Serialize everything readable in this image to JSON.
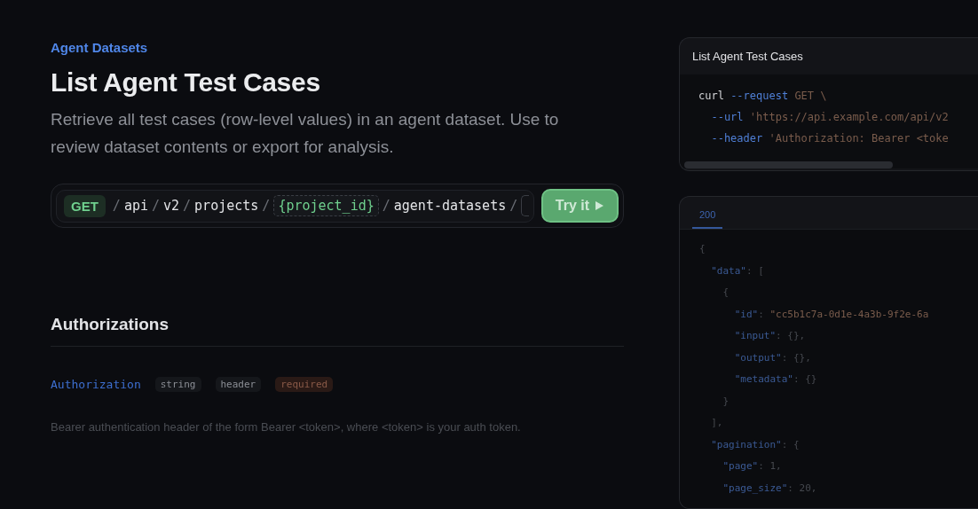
{
  "breadcrumb": "Agent Datasets",
  "title": "List Agent Test Cases",
  "description": "Retrieve all test cases (row-level values) in an agent dataset. Use to review dataset contents or export for analysis.",
  "endpoint": {
    "method": "GET",
    "segments": [
      {
        "kind": "sep",
        "text": "/"
      },
      {
        "kind": "path",
        "text": "api"
      },
      {
        "kind": "sep",
        "text": "/"
      },
      {
        "kind": "path",
        "text": "v2"
      },
      {
        "kind": "sep",
        "text": "/"
      },
      {
        "kind": "path",
        "text": "projects"
      },
      {
        "kind": "sep",
        "text": "/"
      },
      {
        "kind": "param",
        "text": "{project_id}"
      },
      {
        "kind": "sep",
        "text": "/"
      },
      {
        "kind": "path",
        "text": "agent-datasets"
      },
      {
        "kind": "sep",
        "text": "/"
      },
      {
        "kind": "param_cut"
      }
    ],
    "button": "Try it"
  },
  "authorizations": {
    "heading": "Authorizations",
    "params": [
      {
        "name": "Authorization",
        "type": "string",
        "location": "header",
        "required": "required",
        "description": "Bearer authentication header of the form Bearer <token>, where <token> is your auth token."
      }
    ]
  },
  "request_card": {
    "title": "List Agent Test Cases",
    "lines": [
      [
        {
          "kind": "plain",
          "text": "curl "
        },
        {
          "kind": "flag",
          "text": "--request"
        },
        {
          "kind": "string",
          "text": " GET \\"
        }
      ],
      [
        {
          "kind": "flag",
          "text": "  --url"
        },
        {
          "kind": "string",
          "text": " 'https://api.example.com/api/v2"
        }
      ],
      [
        {
          "kind": "flag",
          "text": "  --header"
        },
        {
          "kind": "string",
          "text": " 'Authorization: Bearer <toke"
        }
      ]
    ]
  },
  "response_card": {
    "tabs": [
      {
        "label": "200",
        "selected": true
      }
    ],
    "lines": [
      [
        {
          "kind": "punct",
          "text": "{"
        }
      ],
      [
        {
          "kind": "key",
          "text": "  \"data\""
        },
        {
          "kind": "punct",
          "text": ": ["
        }
      ],
      [
        {
          "kind": "punct",
          "text": "    {"
        }
      ],
      [
        {
          "kind": "key",
          "text": "      \"id\""
        },
        {
          "kind": "punct",
          "text": ": "
        },
        {
          "kind": "string",
          "text": "\"cc5b1c7a-0d1e-4a3b-9f2e-6a"
        }
      ],
      [
        {
          "kind": "key",
          "text": "      \"input\""
        },
        {
          "kind": "punct",
          "text": ": {},"
        }
      ],
      [
        {
          "kind": "key",
          "text": "      \"output\""
        },
        {
          "kind": "punct",
          "text": ": {},"
        }
      ],
      [
        {
          "kind": "key",
          "text": "      \"metadata\""
        },
        {
          "kind": "punct",
          "text": ": {}"
        }
      ],
      [
        {
          "kind": "punct",
          "text": "    }"
        }
      ],
      [
        {
          "kind": "punct",
          "text": "  ],"
        }
      ],
      [
        {
          "kind": "key",
          "text": "  \"pagination\""
        },
        {
          "kind": "punct",
          "text": ": {"
        }
      ],
      [
        {
          "kind": "key",
          "text": "    \"page\""
        },
        {
          "kind": "punct",
          "text": ": 1,"
        }
      ],
      [
        {
          "kind": "key",
          "text": "    \"page_size\""
        },
        {
          "kind": "punct",
          "text": ": 20,"
        }
      ]
    ]
  }
}
